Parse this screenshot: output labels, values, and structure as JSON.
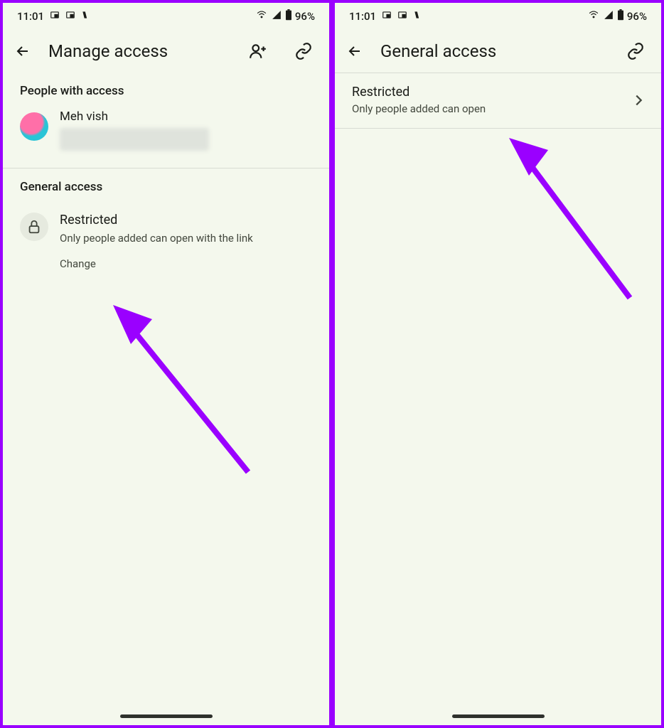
{
  "status": {
    "time": "11:01",
    "battery": "96%"
  },
  "screen1": {
    "title": "Manage access",
    "people_header": "People with access",
    "person_name": "Meh vish",
    "general_header": "General access",
    "restricted_title": "Restricted",
    "restricted_sub": "Only people added can open with the link",
    "change": "Change"
  },
  "screen2": {
    "title": "General access",
    "restricted_title": "Restricted",
    "restricted_sub": "Only people added can open"
  }
}
